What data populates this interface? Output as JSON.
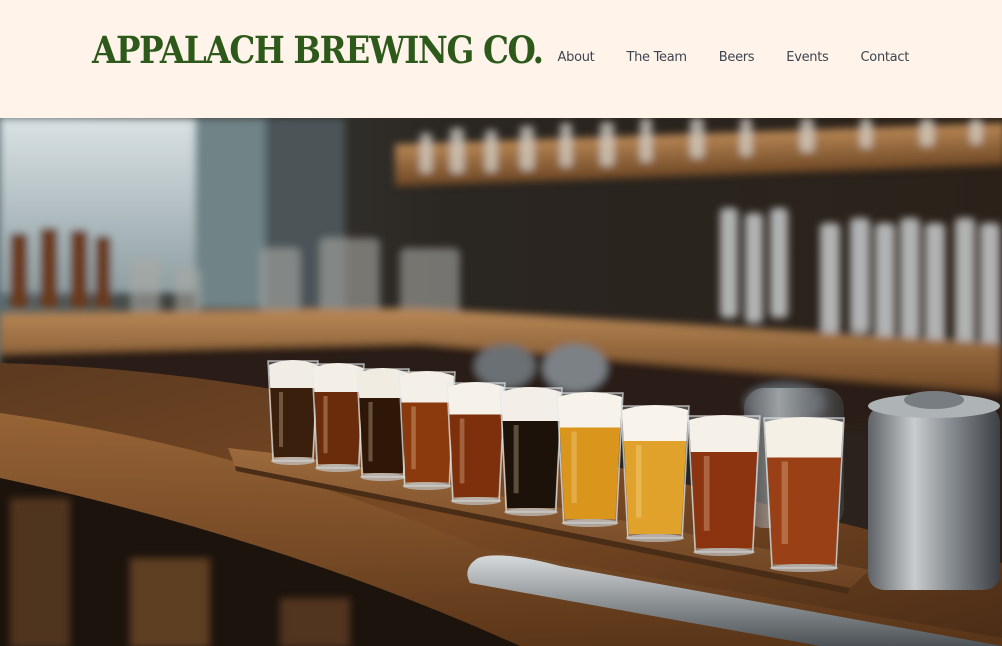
{
  "header": {
    "logo_text": "APPALACH BREWING CO."
  },
  "nav": {
    "items": [
      {
        "label": "About"
      },
      {
        "label": "The Team"
      },
      {
        "label": "Beers"
      },
      {
        "label": "Events"
      },
      {
        "label": "Contact"
      }
    ]
  },
  "hero": {
    "flight": [
      {
        "beer": "#3a1f0c",
        "foam": "#f2ede4"
      },
      {
        "beer": "#6b2c0c",
        "foam": "#f4efe6"
      },
      {
        "beer": "#2f1708",
        "foam": "#f1ece2"
      },
      {
        "beer": "#8a3a0d",
        "foam": "#f5f0e7"
      },
      {
        "beer": "#7e2f0c",
        "foam": "#f6f2ea"
      },
      {
        "beer": "#1d120a",
        "foam": "#f3efe8"
      },
      {
        "beer": "#d9951c",
        "foam": "#f7f3ea"
      },
      {
        "beer": "#e0a22a",
        "foam": "#f8f4ec"
      },
      {
        "beer": "#8c3310",
        "foam": "#f6f1e8"
      },
      {
        "beer": "#9a4016",
        "foam": "#f5f0e6"
      }
    ]
  }
}
